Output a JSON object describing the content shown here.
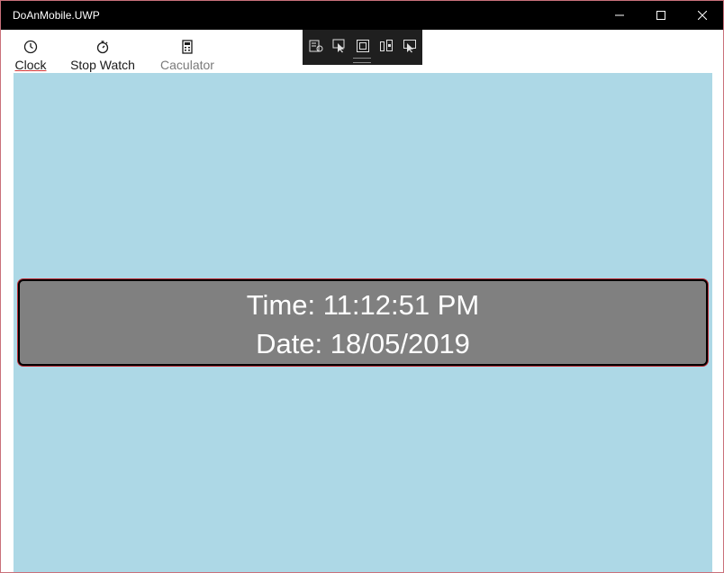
{
  "window": {
    "title": "DoAnMobile.UWP",
    "controls": [
      "minimize",
      "maximize",
      "close"
    ]
  },
  "nav": {
    "items": [
      {
        "label": "Clock",
        "icon": "clock-icon",
        "selected": true
      },
      {
        "label": "Stop Watch",
        "icon": "stopwatch-icon"
      },
      {
        "label": "Caculator",
        "icon": "calculator-icon",
        "disabled": true
      }
    ]
  },
  "debug_toolbar": {
    "icons": [
      "live-visual-tree-icon",
      "select-element-icon",
      "display-layout-adorners-icon",
      "track-focus-icon",
      "preview-selection-icon"
    ]
  },
  "clock": {
    "time_text": "Time: 11:12:51 PM",
    "date_text": "Date: 18/05/2019"
  },
  "colors": {
    "titlebar": "#000000",
    "content_background": "#add8e6",
    "panel_background": "#808080",
    "panel_border": "#000000",
    "accent_underline": "#d43a3a"
  }
}
